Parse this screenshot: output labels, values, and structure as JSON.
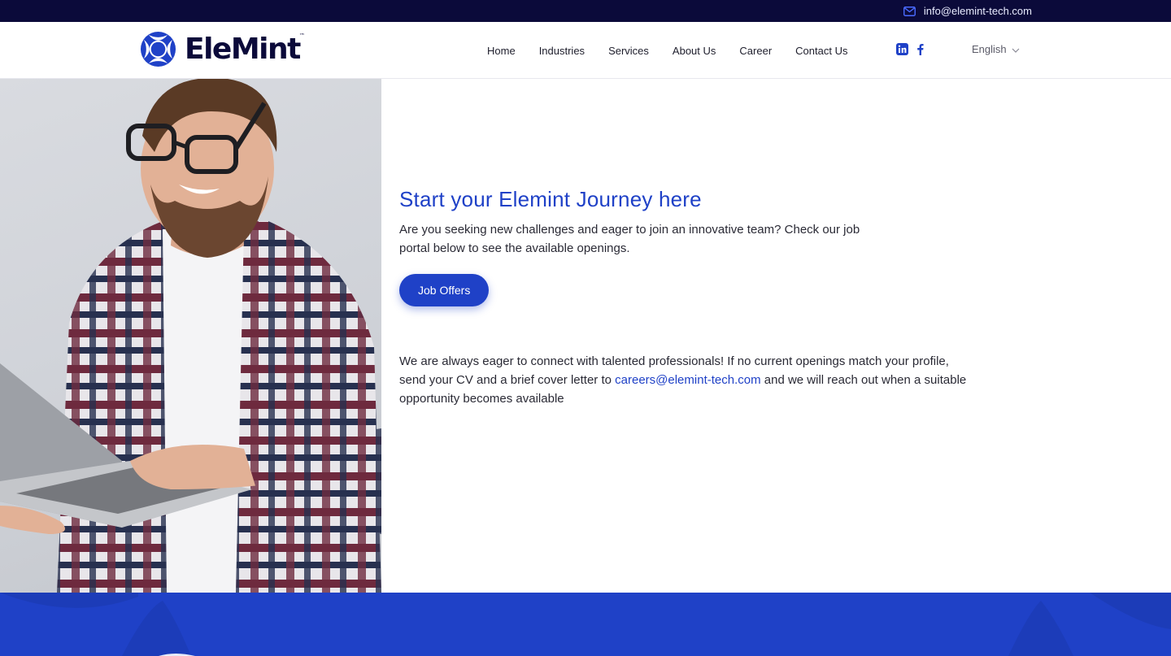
{
  "topbar": {
    "email": "info@elemint-tech.com",
    "mail_icon": "mail-icon"
  },
  "brand": {
    "name": "EleMint",
    "tm": "™"
  },
  "nav": {
    "items": [
      {
        "label": "Home"
      },
      {
        "label": "Industries"
      },
      {
        "label": "Services"
      },
      {
        "label": "About Us"
      },
      {
        "label": "Career"
      },
      {
        "label": "Contact Us"
      }
    ],
    "social": [
      "linkedin-icon",
      "facebook-icon"
    ],
    "language": "English"
  },
  "hero": {
    "title": "Start your Elemint Journey here",
    "intro": "Are you seeking new challenges and eager to join an innovative team? Check our job portal below to see the available openings.",
    "button_label": "Job Offers",
    "cta_text_before": "We are always eager to connect with talented professionals! If no current openings match your profile, send your CV and a brief cover letter to ",
    "cta_email": "careers@elemint-tech.com",
    "cta_text_after": " and we will reach out when a suitable opportunity becomes available"
  },
  "colors": {
    "accent": "#1f41c7",
    "dark": "#0b0a3a"
  }
}
